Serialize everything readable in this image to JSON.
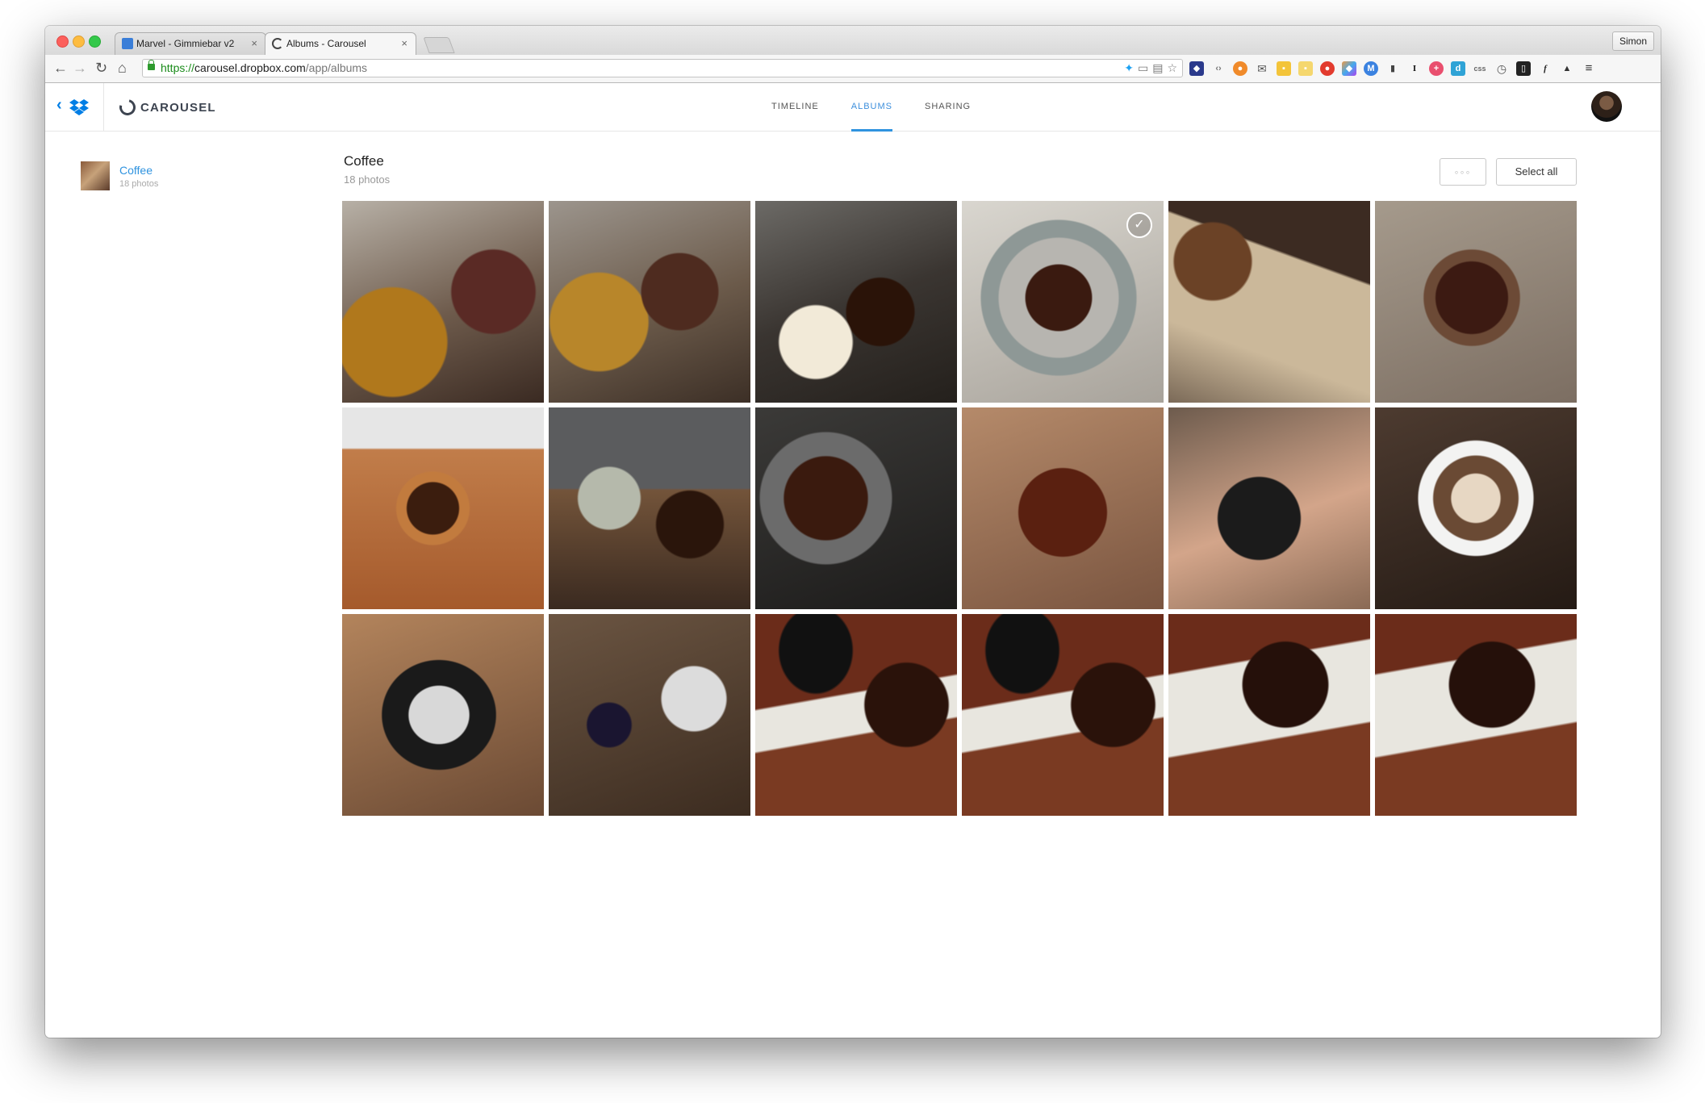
{
  "browser": {
    "tabs": [
      {
        "title": "Marvel - Gimmiebar v2",
        "active": false
      },
      {
        "title": "Albums - Carousel",
        "active": true
      }
    ],
    "profile_name": "Simon",
    "url": {
      "scheme": "https://",
      "host": "carousel.dropbox.com",
      "path": "/app/albums"
    }
  },
  "app": {
    "brand": "CAROUSEL",
    "nav": [
      {
        "label": "TIMELINE",
        "active": false
      },
      {
        "label": "ALBUMS",
        "active": true
      },
      {
        "label": "SHARING",
        "active": false
      }
    ],
    "accent_color": "#2f93df"
  },
  "sidebar": {
    "album": {
      "name": "Coffee",
      "count": "18 photos"
    }
  },
  "album": {
    "title": "Coffee",
    "count": "18 photos",
    "more_label": "◦◦◦",
    "select_all_label": "Select all",
    "photos": [
      {
        "selected": false
      },
      {
        "selected": false
      },
      {
        "selected": false
      },
      {
        "selected": true
      },
      {
        "selected": false
      },
      {
        "selected": false
      },
      {
        "selected": false
      },
      {
        "selected": false
      },
      {
        "selected": false
      },
      {
        "selected": false
      },
      {
        "selected": false
      },
      {
        "selected": false
      },
      {
        "selected": false
      },
      {
        "selected": false
      },
      {
        "selected": false
      },
      {
        "selected": false
      },
      {
        "selected": false
      },
      {
        "selected": false
      }
    ]
  }
}
